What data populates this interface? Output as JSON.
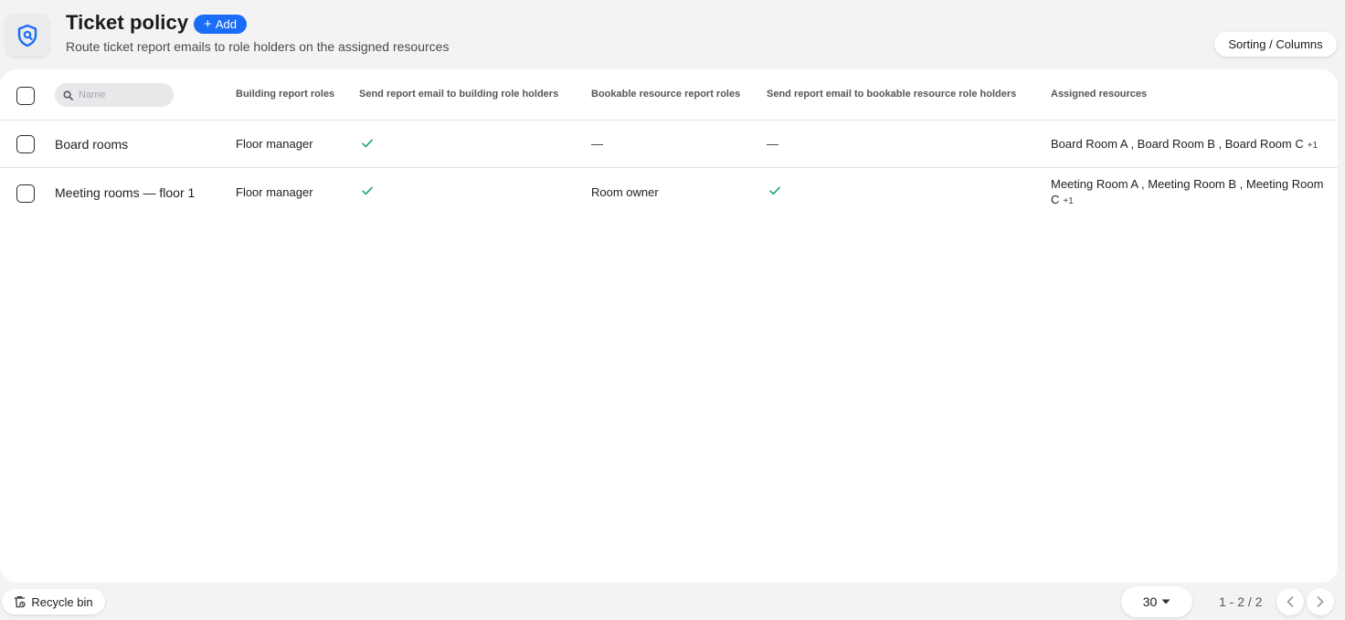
{
  "header": {
    "title": "Ticket policy",
    "add_label": "Add",
    "subtitle": "Route ticket report emails to role holders on the assigned resources",
    "sorting_label": "Sorting / Columns",
    "app_icon": "shield-icon"
  },
  "table": {
    "search": {
      "placeholder": "Name",
      "value": ""
    },
    "columns": [
      "Building report roles",
      "Send report email to building role holders",
      "Bookable resource report roles",
      "Send report email to bookable resource role holders",
      "Assigned resources"
    ],
    "rows": [
      {
        "name": "Board rooms",
        "building_roles": "Floor manager",
        "send_building": true,
        "bookable_roles": "—",
        "send_bookable": "—",
        "assigned": "Board Room A , Board Room B , Board Room C",
        "more": "+1"
      },
      {
        "name": "Meeting rooms — floor 1",
        "building_roles": "Floor manager",
        "send_building": true,
        "bookable_roles": "Room owner",
        "send_bookable": true,
        "assigned": "Meeting Room A , Meeting Room B , Meeting Room C",
        "more": "+1"
      }
    ]
  },
  "footer": {
    "recycle_label": "Recycle bin",
    "per_page": "30",
    "page_info": "1 - 2 / 2"
  },
  "colors": {
    "accent": "#1a6ef5",
    "check": "#1aa37a"
  }
}
